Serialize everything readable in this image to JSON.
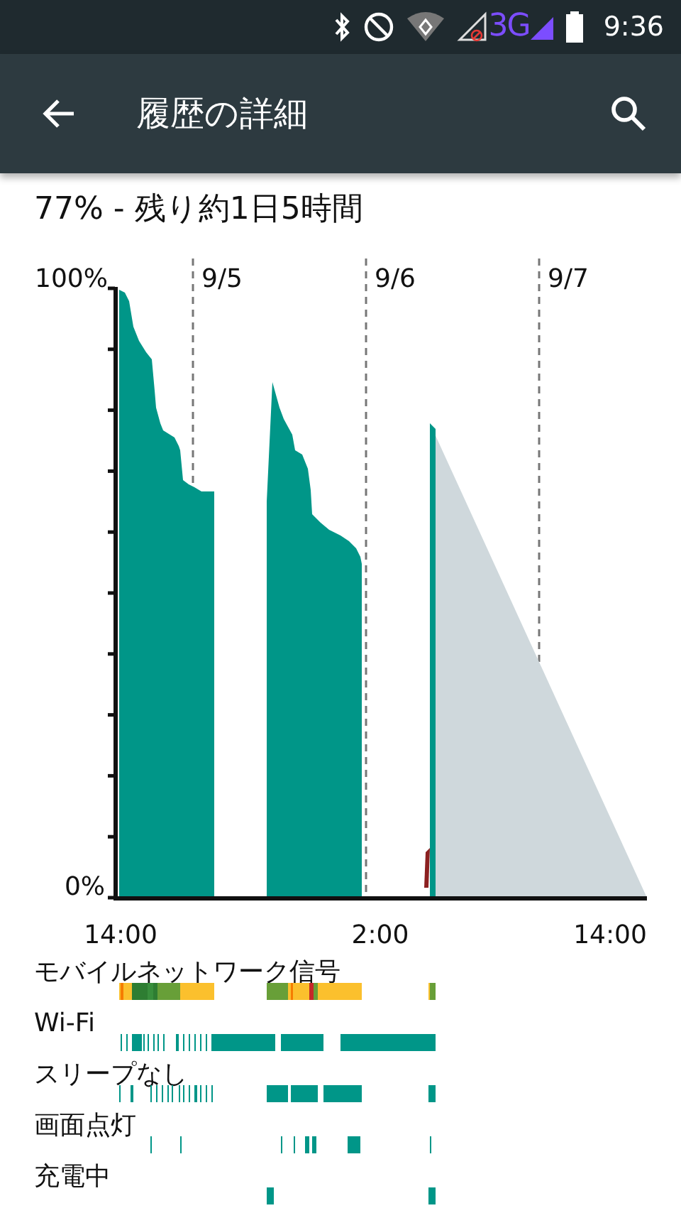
{
  "status_bar": {
    "network_type": "3G",
    "time": "9:36"
  },
  "toolbar": {
    "title": "履歴の詳細"
  },
  "summary": "77% - 残り約1日5時間",
  "graph": {
    "y_labels": [
      "100%",
      "0%"
    ],
    "date_labels": [
      "9/5",
      "9/6",
      "9/7"
    ],
    "time_labels": [
      "14:00",
      "2:00",
      "14:00"
    ]
  },
  "timelines": [
    {
      "label": "モバイルネットワーク信号",
      "kind": "signal"
    },
    {
      "label": "Wi-Fi",
      "kind": "wifi"
    },
    {
      "label": "スリープなし",
      "kind": "awake"
    },
    {
      "label": "画面点灯",
      "kind": "screen"
    },
    {
      "label": "充電中",
      "kind": "charging"
    }
  ]
}
